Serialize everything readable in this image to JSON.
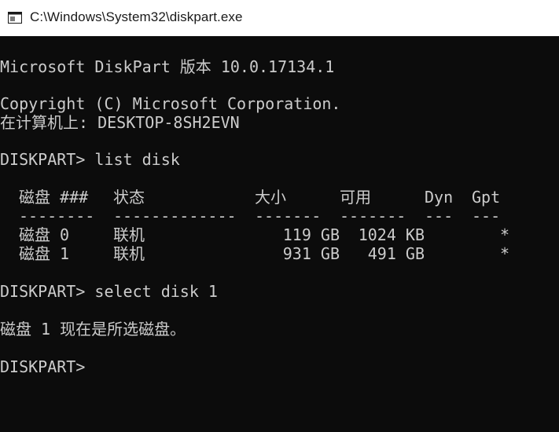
{
  "window": {
    "title": "C:\\Windows\\System32\\diskpart.exe",
    "icon": "console-window-icon"
  },
  "colors": {
    "console_background": "#0c0c0c",
    "console_text": "#cccccc",
    "titlebar_background": "#ffffff",
    "titlebar_text": "#1a1a1a"
  },
  "console": {
    "version_line": "Microsoft DiskPart 版本 10.0.17134.1",
    "copyright_line": "Copyright (C) Microsoft Corporation.",
    "computer_line": "在计算机上: DESKTOP-8SH2EVN",
    "prompt1": "DISKPART> list disk",
    "disk_table": {
      "headers": {
        "disk": "磁盘 ###",
        "status": "状态",
        "size": "大小",
        "free": "可用",
        "dyn": "Dyn",
        "gpt": "Gpt"
      },
      "separators": {
        "disk": "--------",
        "status": "-------------",
        "size": "-------",
        "free": "-------",
        "dyn": "---",
        "gpt": "---"
      },
      "rows": [
        {
          "disk": "磁盘 0",
          "status": "联机",
          "size": "119 GB",
          "free": "1024 KB",
          "dyn": "",
          "gpt": "*"
        },
        {
          "disk": "磁盘 1",
          "status": "联机",
          "size": "931 GB",
          "free": "491 GB",
          "dyn": "",
          "gpt": "*"
        }
      ]
    },
    "prompt2": "DISKPART> select disk 1",
    "result_line": "磁盘 1 现在是所选磁盘。",
    "prompt3": "DISKPART>"
  }
}
